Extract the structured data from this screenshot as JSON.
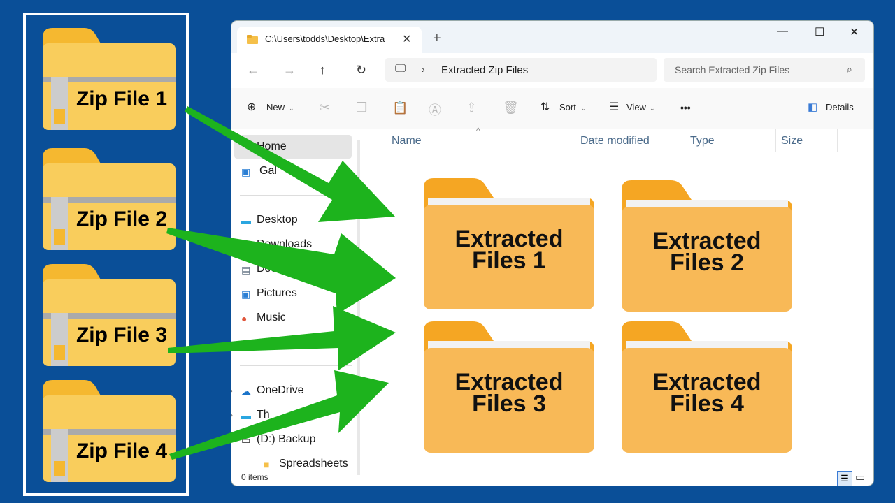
{
  "zip_files": [
    {
      "label": "Zip File 1"
    },
    {
      "label": "Zip File 2"
    },
    {
      "label": "Zip File 3"
    },
    {
      "label": "Zip File 4"
    }
  ],
  "window": {
    "tab_title": "C:\\Users\\todds\\Desktop\\Extra",
    "address": "Extracted Zip Files",
    "search_placeholder": "Search Extracted Zip Files"
  },
  "toolbar": {
    "new_label": "New",
    "sort_label": "Sort",
    "view_label": "View",
    "more_label": "•••",
    "details_label": "Details"
  },
  "sidebar": {
    "items": [
      {
        "label": "Home"
      },
      {
        "label": "Gal"
      },
      {
        "label": "Desktop"
      },
      {
        "label": "Downloads"
      },
      {
        "label": "Docum"
      },
      {
        "label": "Pictures"
      },
      {
        "label": "Music"
      },
      {
        "label": "OneDrive"
      },
      {
        "label": "Th"
      },
      {
        "label": "(D:) Backup"
      },
      {
        "label": "Spreadsheets"
      }
    ]
  },
  "columns": {
    "name": "Name",
    "date": "Date modified",
    "type": "Type",
    "size": "Size"
  },
  "status": "0 items",
  "folders": [
    {
      "line1": "Extracted",
      "line2": "Files 1"
    },
    {
      "line1": "Extracted",
      "line2": "Files 2"
    },
    {
      "line1": "Extracted",
      "line2": "Files 3"
    },
    {
      "line1": "Extracted",
      "line2": "Files 4"
    }
  ],
  "colors": {
    "background": "#0a4f98",
    "arrow": "#1db31d",
    "folder": "#f6b04c"
  }
}
